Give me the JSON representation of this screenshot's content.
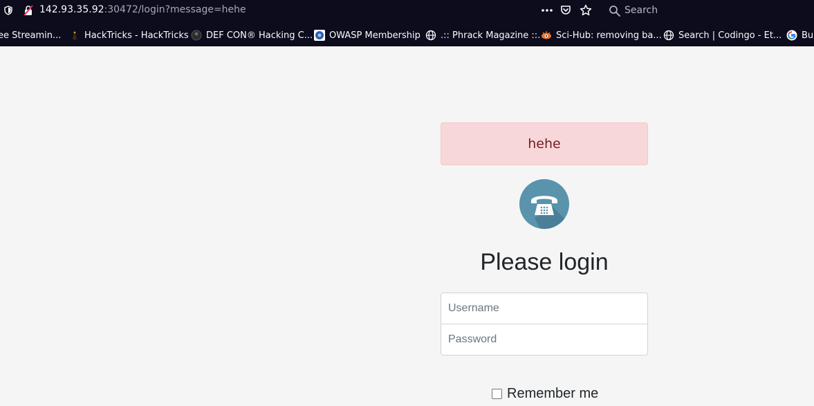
{
  "browser": {
    "url_host": "142.93.35.92",
    "url_rest": ":30472/login?message=hehe",
    "search_placeholder": "Search"
  },
  "bookmarks": [
    {
      "label": "ee Streamin...",
      "icon": "none"
    },
    {
      "label": "HackTricks - HackTricks",
      "icon": "hacktricks-icon"
    },
    {
      "label": "DEF CON® Hacking C...",
      "icon": "defcon-icon"
    },
    {
      "label": "OWASP Membership",
      "icon": "owasp-icon"
    },
    {
      "label": ".:: Phrack Magazine ::.",
      "icon": "globe-icon"
    },
    {
      "label": "Sci-Hub: removing ba...",
      "icon": "scihub-icon"
    },
    {
      "label": "Search | Codingo - Et...",
      "icon": "globe-icon"
    },
    {
      "label": "Bu",
      "icon": "google-icon"
    }
  ],
  "alert": {
    "message": "hehe"
  },
  "login": {
    "title": "Please login",
    "username_placeholder": "Username",
    "password_placeholder": "Password",
    "remember_label": "Remember me"
  },
  "colors": {
    "toolbar_bg": "#0c0c1d",
    "page_bg": "#f5f5f5",
    "alert_bg": "#f8d7da",
    "alert_text": "#721c24",
    "logo_circle": "#5a93ac"
  }
}
